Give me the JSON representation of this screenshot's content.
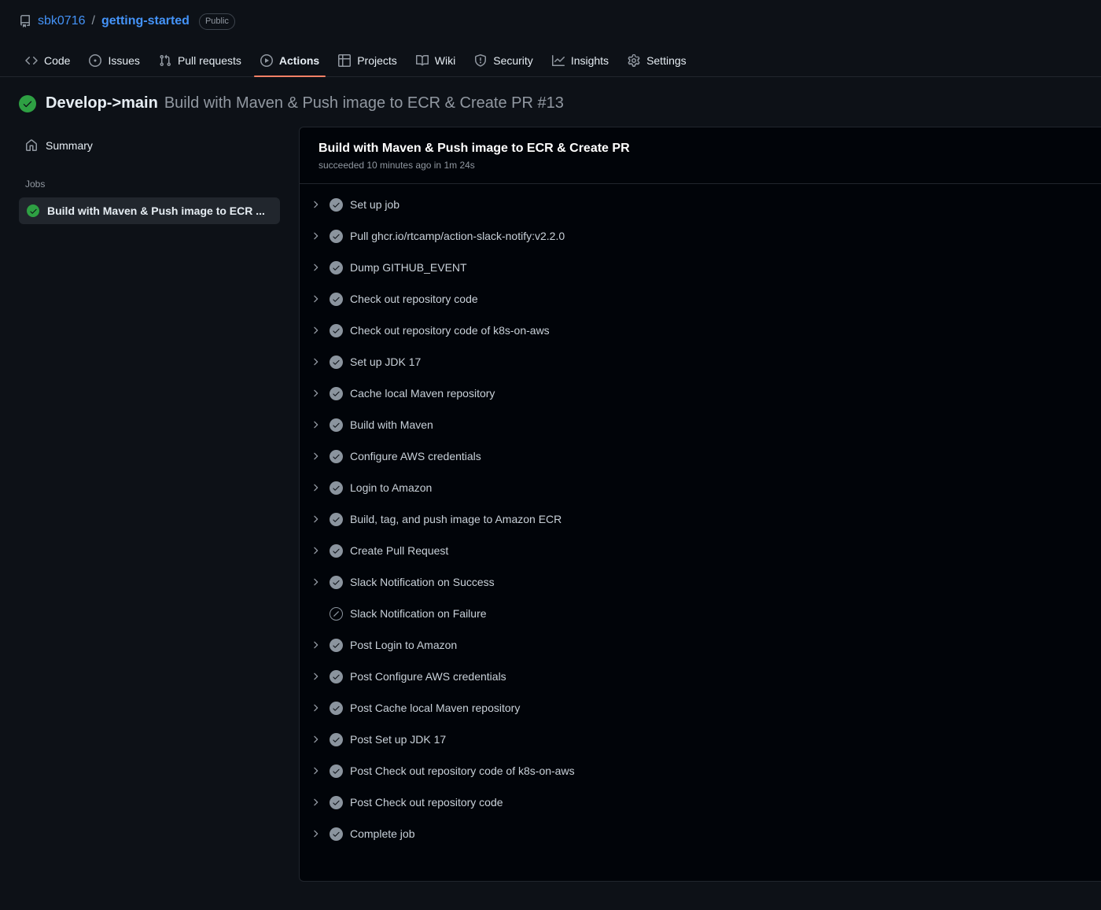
{
  "repo": {
    "icon": "repo-icon",
    "owner": "sbk0716",
    "separator": "/",
    "name": "getting-started",
    "visibility": "Public"
  },
  "nav": {
    "tabs": [
      {
        "label": "Code",
        "icon": "code-icon",
        "active": false
      },
      {
        "label": "Issues",
        "icon": "issue-opened-icon",
        "active": false
      },
      {
        "label": "Pull requests",
        "icon": "git-pull-request-icon",
        "active": false
      },
      {
        "label": "Actions",
        "icon": "play-icon",
        "active": true
      },
      {
        "label": "Projects",
        "icon": "table-icon",
        "active": false
      },
      {
        "label": "Wiki",
        "icon": "book-icon",
        "active": false
      },
      {
        "label": "Security",
        "icon": "shield-icon",
        "active": false
      },
      {
        "label": "Insights",
        "icon": "graph-icon",
        "active": false
      },
      {
        "label": "Settings",
        "icon": "gear-icon",
        "active": false
      }
    ]
  },
  "run": {
    "status_icon": "check-circle-fill-icon",
    "branch": "Develop->main",
    "title": "Build with Maven & Push image to ECR & Create PR #13"
  },
  "sidebar": {
    "summary": {
      "label": "Summary",
      "icon": "home-icon"
    },
    "jobs_heading": "Jobs",
    "jobs": [
      {
        "label": "Build with Maven & Push image to ECR ...",
        "status": "success",
        "selected": true
      }
    ]
  },
  "log": {
    "title": "Build with Maven & Push image to ECR & Create PR",
    "subtitle": "succeeded 10 minutes ago in 1m 24s",
    "steps": [
      {
        "label": "Set up job",
        "status": "success",
        "expandable": true
      },
      {
        "label": "Pull ghcr.io/rtcamp/action-slack-notify:v2.2.0",
        "status": "success",
        "expandable": true
      },
      {
        "label": "Dump GITHUB_EVENT",
        "status": "success",
        "expandable": true
      },
      {
        "label": "Check out repository code",
        "status": "success",
        "expandable": true
      },
      {
        "label": "Check out repository code of k8s-on-aws",
        "status": "success",
        "expandable": true
      },
      {
        "label": "Set up JDK 17",
        "status": "success",
        "expandable": true
      },
      {
        "label": "Cache local Maven repository",
        "status": "success",
        "expandable": true
      },
      {
        "label": "Build with Maven",
        "status": "success",
        "expandable": true
      },
      {
        "label": "Configure AWS credentials",
        "status": "success",
        "expandable": true
      },
      {
        "label": "Login to Amazon",
        "status": "success",
        "expandable": true
      },
      {
        "label": "Build, tag, and push image to Amazon ECR",
        "status": "success",
        "expandable": true
      },
      {
        "label": "Create Pull Request",
        "status": "success",
        "expandable": true
      },
      {
        "label": "Slack Notification on Success",
        "status": "success",
        "expandable": true
      },
      {
        "label": "Slack Notification on Failure",
        "status": "skipped",
        "expandable": false
      },
      {
        "label": "Post Login to Amazon",
        "status": "success",
        "expandable": true
      },
      {
        "label": "Post Configure AWS credentials",
        "status": "success",
        "expandable": true
      },
      {
        "label": "Post Cache local Maven repository",
        "status": "success",
        "expandable": true
      },
      {
        "label": "Post Set up JDK 17",
        "status": "success",
        "expandable": true
      },
      {
        "label": "Post Check out repository code of k8s-on-aws",
        "status": "success",
        "expandable": true
      },
      {
        "label": "Post Check out repository code",
        "status": "success",
        "expandable": true
      },
      {
        "label": "Complete job",
        "status": "success",
        "expandable": true
      }
    ]
  },
  "colors": {
    "background": "#0d1117",
    "panel": "#010409",
    "accent_active_tab": "#f78166",
    "link": "#4493f8",
    "success_green": "#2ea043",
    "muted_text": "#9198a1",
    "selected_row": "#21262d"
  }
}
